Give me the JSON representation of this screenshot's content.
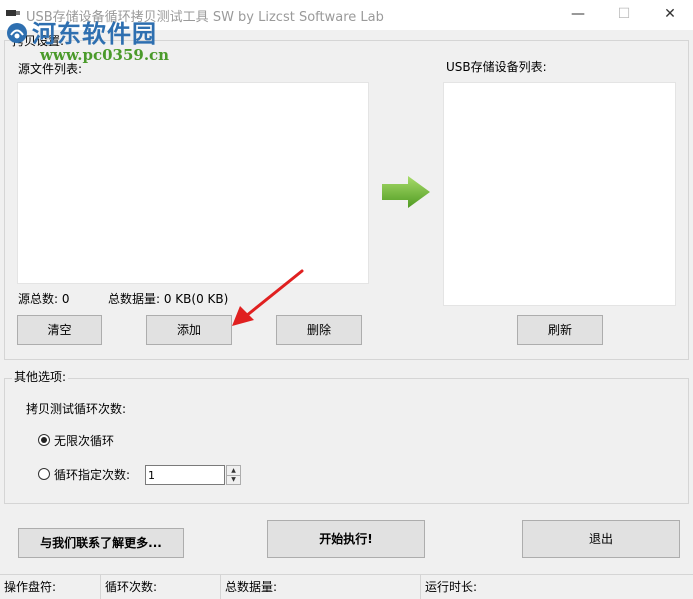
{
  "window": {
    "title": "USB存储设备循环拷贝测试工具 SW  by Lizcst Software Lab",
    "minimize_glyph": "—",
    "maximize_glyph": "☐",
    "close_glyph": "✕"
  },
  "watermark": {
    "site_name": "河东软件园",
    "url": "www.pc0359.cn"
  },
  "copy_settings": {
    "group_label": "拷贝设置:",
    "source_list_label": "源文件列表:",
    "usb_list_label": "USB存储设备列表:",
    "source_count_label": "源总数: 0",
    "total_size_label": "总数据量: 0 KB(0 KB)",
    "source_files": [],
    "usb_devices": [],
    "buttons": {
      "clear": "清空",
      "add": "添加",
      "delete": "删除",
      "refresh": "刷新"
    }
  },
  "other_options": {
    "group_label": "其他选项:",
    "loop_count_label": "拷贝测试循环次数:",
    "radio_infinite": "无限次循环",
    "radio_specified": "循环指定次数:",
    "selected_mode": "infinite",
    "loop_count_value": "1"
  },
  "actions": {
    "contact": "与我们联系了解更多...",
    "start": "开始执行!",
    "exit": "退出"
  },
  "statusbar": {
    "drive": "操作盘符:",
    "loops": "循环次数:",
    "total_data": "总数据量:",
    "runtime": "运行时长:"
  },
  "colors": {
    "arrow_green": "#6cb83a",
    "annotation_red": "#e02020",
    "watermark_blue": "#2e6fb0",
    "watermark_green": "#4a9a2a"
  }
}
